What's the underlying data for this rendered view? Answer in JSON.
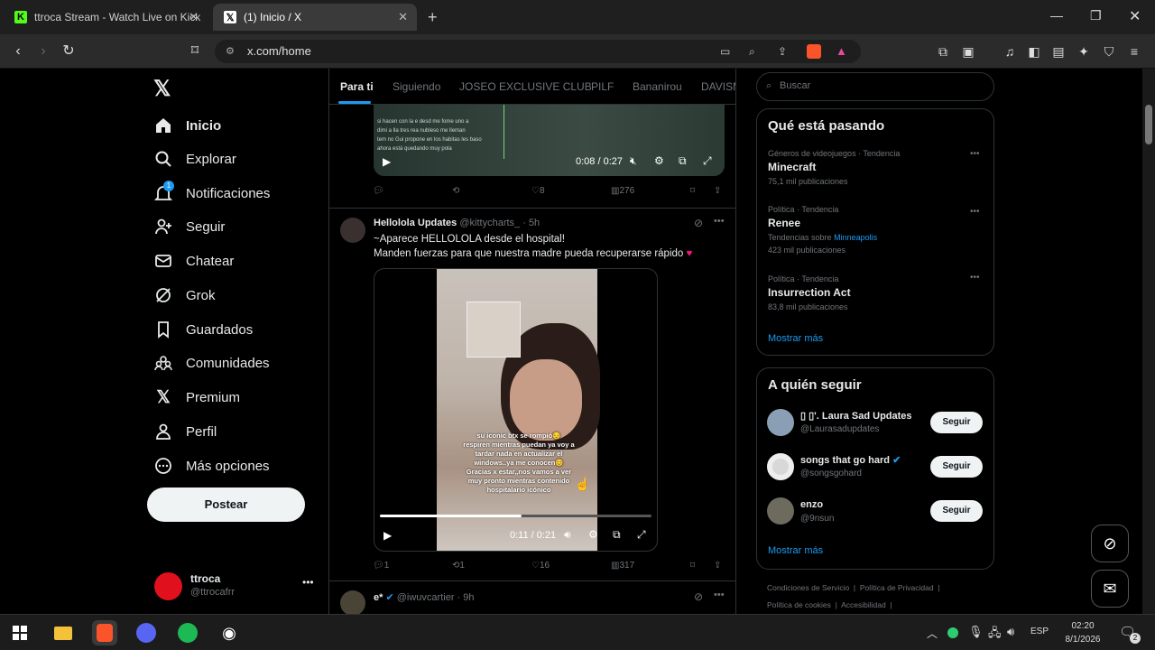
{
  "browser": {
    "tabs": [
      {
        "title": "ttroca Stream - Watch Live on Kick",
        "active": false
      },
      {
        "title": "(1) Inicio / X",
        "active": true
      }
    ],
    "new_tab_icon": "+",
    "url": "x.com/home"
  },
  "nav": {
    "items": [
      {
        "label": "Inicio",
        "icon": "home-icon"
      },
      {
        "label": "Explorar",
        "icon": "search-icon"
      },
      {
        "label": "Notificaciones",
        "icon": "bell-icon",
        "badge": "1"
      },
      {
        "label": "Seguir",
        "icon": "add-user-icon"
      },
      {
        "label": "Chatear",
        "icon": "mail-icon"
      },
      {
        "label": "Grok",
        "icon": "grok-icon"
      },
      {
        "label": "Guardados",
        "icon": "bookmark-icon"
      },
      {
        "label": "Comunidades",
        "icon": "communities-icon"
      },
      {
        "label": "Premium",
        "icon": "x-logo-icon"
      },
      {
        "label": "Perfil",
        "icon": "person-icon"
      },
      {
        "label": "Más opciones",
        "icon": "more-circle-icon"
      }
    ],
    "post_button": "Postear",
    "account": {
      "name": "ttroca",
      "handle": "@ttrocafrr"
    }
  },
  "feed": {
    "tabs": [
      "Para ti",
      "Siguiendo",
      "JOSEO EXCLUSIVE CLUB",
      "PILF",
      "Bananirou",
      "DAVISM"
    ],
    "active_tab": "Para ti",
    "top_video": {
      "time": "0:08 / 0:27",
      "caption_lines": [
        "si hacen con la e desd me fome uno a",
        "dimi a lla tres rea nubleso me lleman",
        "tem no Gui propone en los habitas les baso",
        "ahora está quedando muy pola"
      ]
    },
    "top_actions": {
      "replies": "",
      "reposts": "",
      "likes": "8",
      "views": "276"
    },
    "post": {
      "author": "Hellolola Updates",
      "handle": "@kittycharts_",
      "time": "· 5h",
      "line1": "~Aparece HELLOLOLA desde el hospital!",
      "line2": "Manden fuerzas para que nuestra madre pueda recuperarse rápido",
      "video_time": "0:11 / 0:21",
      "video_caption": "su iconic btx se rompió😔 respiren mientras puedan ya voy a tardar nada en actualizar el windows..ya me conocen😊 Gracias x estar,,nos vamos a ver muy pronto mientras contenido hospitalario icónico",
      "replies": "1",
      "reposts": "1",
      "likes": "16",
      "views": "317"
    },
    "next_post": {
      "author": "e*",
      "handle": "@iwuvcartier",
      "time": "· 9h"
    }
  },
  "right": {
    "search_placeholder": "Buscar",
    "trends_title": "Qué está pasando",
    "trends": [
      {
        "meta": "Géneros de videojuegos · Tendencia",
        "name": "Minecraft",
        "extra": "",
        "extra_link": "",
        "count": "75,1 mil publicaciones"
      },
      {
        "meta": "Política · Tendencia",
        "name": "Renee",
        "extra": "Tendencias sobre",
        "extra_link": "Minneapolis",
        "count": "423 mil publicaciones"
      },
      {
        "meta": "Política · Tendencia",
        "name": "Insurrection Act",
        "extra": "",
        "extra_link": "",
        "count": "83,8 mil publicaciones"
      }
    ],
    "show_more": "Mostrar más",
    "follow_title": "A quién seguir",
    "follow": [
      {
        "name": "▯ ▯'. Laura Sad Updates",
        "handle": "@Laurasadupdates",
        "verified": false,
        "button": "Seguir"
      },
      {
        "name": "songs that go hard",
        "handle": "@songsgohard",
        "verified": true,
        "button": "Seguir"
      },
      {
        "name": "enzo",
        "handle": "@9nsun",
        "verified": false,
        "button": "Seguir"
      }
    ],
    "follow_more": "Mostrar más",
    "footer": [
      "Condiciones de Servicio",
      "Política de Privacidad",
      "Política de cookies",
      "Accesibilidad"
    ]
  },
  "taskbar": {
    "language": "ESP",
    "time": "02:20",
    "date": "8/1/2026",
    "notif_count": "2"
  },
  "colors": {
    "accent": "#1d9bf0",
    "bg": "#000000",
    "border": "#2f3336",
    "heart": "#f91880"
  }
}
